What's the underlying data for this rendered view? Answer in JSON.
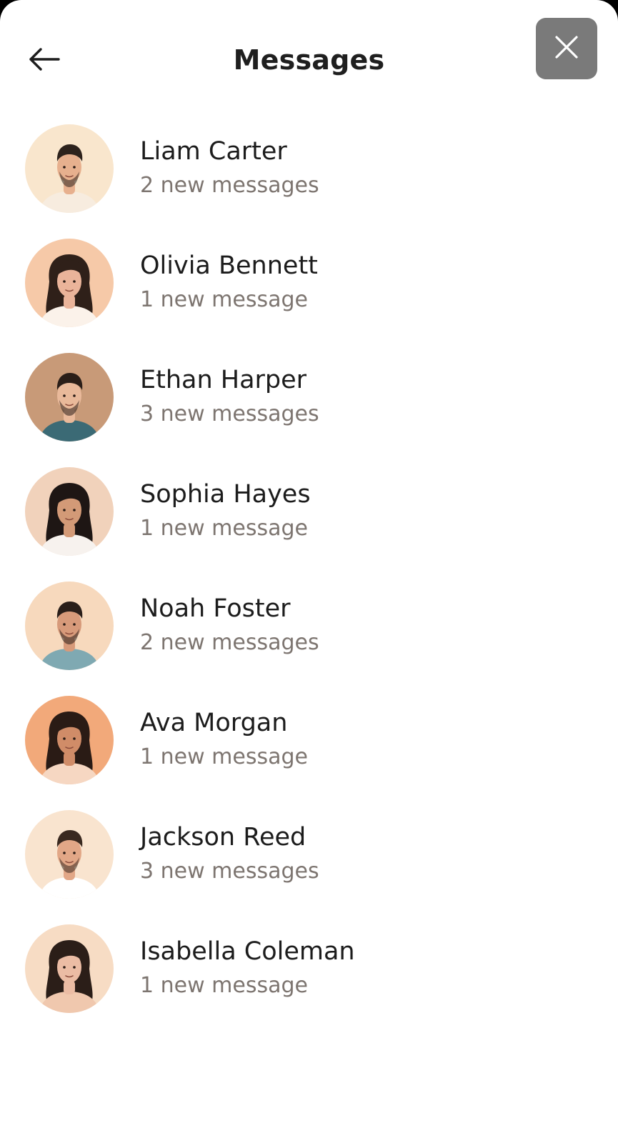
{
  "header": {
    "title": "Messages",
    "back_icon": "arrow-left-icon",
    "close_icon": "close-icon",
    "close_bg": "#7a7a7a"
  },
  "contacts": [
    {
      "name": "Liam Carter",
      "subtitle": "2 new messages",
      "bg": "#f9e6cd",
      "skin": "#e7b08e",
      "hair": "#2d221c",
      "shirt": "#f7ecdf",
      "gender": "m"
    },
    {
      "name": "Olivia Bennett",
      "subtitle": "1 new message",
      "bg": "#f6c9a8",
      "skin": "#eab49a",
      "hair": "#2f2019",
      "shirt": "#fbf2ea",
      "gender": "f"
    },
    {
      "name": "Ethan Harper",
      "subtitle": "3 new messages",
      "bg": "#c89a78",
      "skin": "#e9b99a",
      "hair": "#2a1e18",
      "shirt": "#3b6a75",
      "gender": "m"
    },
    {
      "name": "Sophia Hayes",
      "subtitle": "1 new message",
      "bg": "#f1d2bb",
      "skin": "#d39a77",
      "hair": "#1e1614",
      "shirt": "#f7f2ee",
      "gender": "f"
    },
    {
      "name": "Noah Foster",
      "subtitle": "2 new messages",
      "bg": "#f7d9bd",
      "skin": "#d79a7a",
      "hair": "#2a1f1a",
      "shirt": "#7fa9b2",
      "gender": "m"
    },
    {
      "name": "Ava Morgan",
      "subtitle": "1 new message",
      "bg": "#f2a97a",
      "skin": "#d08c68",
      "hair": "#2a1b15",
      "shirt": "#f6d7c2",
      "gender": "f"
    },
    {
      "name": "Jackson Reed",
      "subtitle": "3 new messages",
      "bg": "#f9e4cf",
      "skin": "#e2a787",
      "hair": "#3a2920",
      "shirt": "#ffffff",
      "gender": "m"
    },
    {
      "name": "Isabella Coleman",
      "subtitle": "1 new message",
      "bg": "#f7dcc4",
      "skin": "#ebbca4",
      "hair": "#2b1e18",
      "shirt": "#f0c8ae",
      "gender": "f"
    }
  ]
}
